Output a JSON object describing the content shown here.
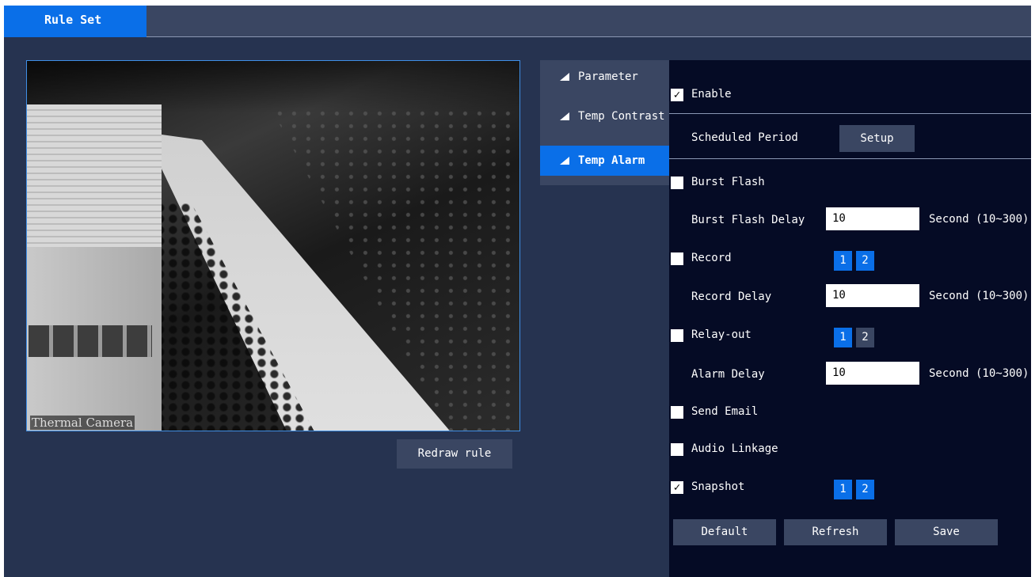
{
  "header": {
    "tab_label": "Rule Set"
  },
  "video": {
    "overlay_label": "Thermal Camera",
    "redraw_label": "Redraw rule"
  },
  "sidenav": {
    "items": [
      {
        "label": "Parameter",
        "active": false
      },
      {
        "label": "Temp Contrast",
        "active": false
      },
      {
        "label": "Temp Alarm",
        "active": true
      }
    ]
  },
  "form": {
    "enable": {
      "label": "Enable",
      "checked": true,
      "mark": "✓"
    },
    "scheduled_period": {
      "label": "Scheduled Period",
      "button": "Setup"
    },
    "burst_flash": {
      "label": "Burst Flash",
      "checked": false
    },
    "burst_flash_delay": {
      "label": "Burst Flash Delay",
      "value": "10",
      "unit": "Second (10~300)"
    },
    "record": {
      "label": "Record",
      "checked": false,
      "channels": [
        {
          "label": "1",
          "selected": true
        },
        {
          "label": "2",
          "selected": true
        }
      ]
    },
    "record_delay": {
      "label": "Record Delay",
      "value": "10",
      "unit": "Second (10~300)"
    },
    "relay_out": {
      "label": "Relay-out",
      "checked": false,
      "channels": [
        {
          "label": "1",
          "selected": true
        },
        {
          "label": "2",
          "selected": false
        }
      ]
    },
    "alarm_delay": {
      "label": "Alarm Delay",
      "value": "10",
      "unit": "Second (10~300)"
    },
    "send_email": {
      "label": "Send Email",
      "checked": false
    },
    "audio_linkage": {
      "label": "Audio Linkage",
      "checked": false
    },
    "snapshot": {
      "label": "Snapshot",
      "checked": true,
      "mark": "✓",
      "channels": [
        {
          "label": "1",
          "selected": true
        },
        {
          "label": "2",
          "selected": true
        }
      ]
    }
  },
  "actions": {
    "default_label": "Default",
    "refresh_label": "Refresh",
    "save_label": "Save"
  },
  "colors": {
    "accent": "#0a6fe8",
    "background": "#263350",
    "panel": "#050b25",
    "button": "#3a4662"
  }
}
